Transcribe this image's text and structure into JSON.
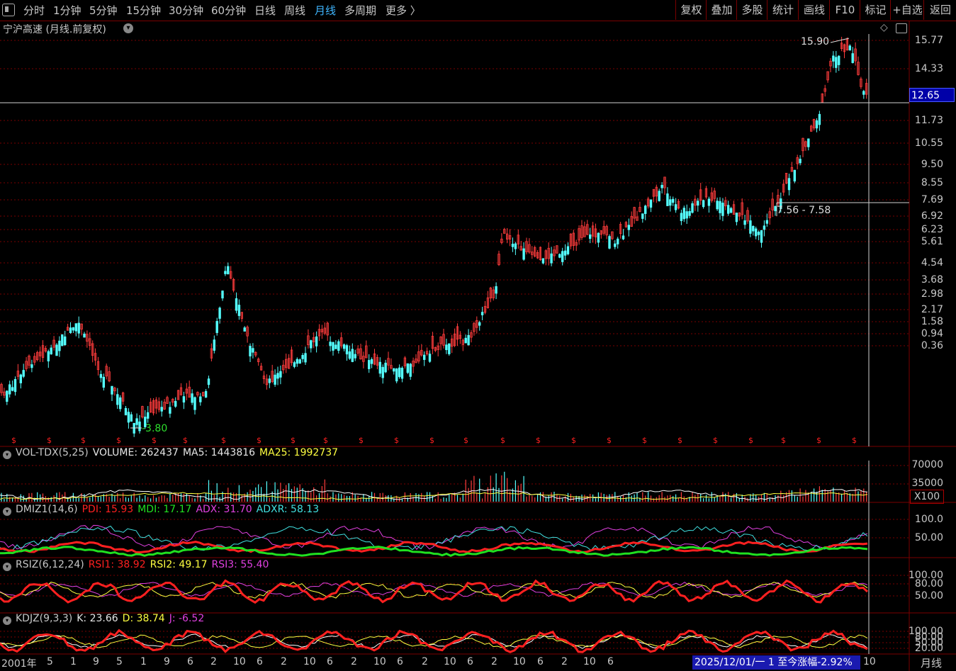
{
  "toolbar": {
    "periods": [
      "分时",
      "1分钟",
      "5分钟",
      "15分钟",
      "30分钟",
      "60分钟",
      "日线",
      "周线",
      "月线",
      "多周期",
      "更多 〉"
    ],
    "active_period": "月线",
    "right_buttons": [
      "复权",
      "叠加",
      "多股",
      "统计",
      "画线",
      "F10",
      "标记",
      "+自选",
      "返回"
    ]
  },
  "title": "宁沪高速 (月线.前复权)",
  "price_axis": [
    "15.77",
    "14.33",
    "11.73",
    "10.55",
    "9.50",
    "8.55",
    "7.69",
    "6.92",
    "6.23",
    "5.61",
    "4.54",
    "3.68",
    "2.98",
    "2.17",
    "1.58",
    "0.94",
    "0.36"
  ],
  "current_price": "12.65",
  "high_label": "15.90",
  "low_label": "-3.80",
  "cursor_range": "7.56 - 7.58",
  "volume_panel": {
    "name": "VOL-TDX(5,25)",
    "volume": "VOLUME: 262437",
    "ma5": "MA5: 1443816",
    "ma25": "MA25: 1992737",
    "axis": [
      "70000",
      "35000"
    ],
    "unit": "X100"
  },
  "dmi_panel": {
    "name": "DMIZ1(14,6)",
    "pdi": "PDI: 15.93",
    "mdi": "MDI: 17.17",
    "adx": "ADX: 31.70",
    "adxr": "ADXR: 58.13",
    "axis": [
      "100.0",
      "50.00"
    ]
  },
  "rsi_panel": {
    "name": "RSIZ(6,12,24)",
    "rsi1": "RSI1: 38.92",
    "rsi2": "RSI2: 49.17",
    "rsi3": "RSI3: 55.40",
    "axis": [
      "100.00",
      "80.00",
      "50.00"
    ]
  },
  "kdj_panel": {
    "name": "KDJZ(9,3,3)",
    "k": "K: 23.66",
    "d": "D: 38.74",
    "j": "J: -6.52",
    "axis": [
      "100.00",
      "80.00",
      "50.00",
      "20.00"
    ]
  },
  "x_axis": [
    "2001年",
    "5",
    "1",
    "9",
    "5",
    "1",
    "9",
    "6",
    "2",
    "10",
    "6",
    "2",
    "10",
    "6",
    "2",
    "10",
    "6",
    "2",
    "10",
    "6",
    "2",
    "10",
    "6",
    "2",
    "10",
    "6"
  ],
  "status_text": "2025/12/01/一 1 至今涨幅-2.92%",
  "status_tail": "10",
  "period_label": "月线",
  "colors": {
    "up": "#ff3c3c",
    "down": "#54ffff",
    "grid": "#7a0000",
    "accent": "#3fb6ff",
    "pdi": "#ff2020",
    "mdi": "#20e020",
    "adx": "#e040e0",
    "adxr": "#40e0e0",
    "yellow": "#ffff40"
  },
  "icons": [
    "menu-toggle-icon",
    "dropdown-arrow-icon",
    "diamond-icon",
    "panel-toggle-icon",
    "dividend-marker-icon"
  ]
}
